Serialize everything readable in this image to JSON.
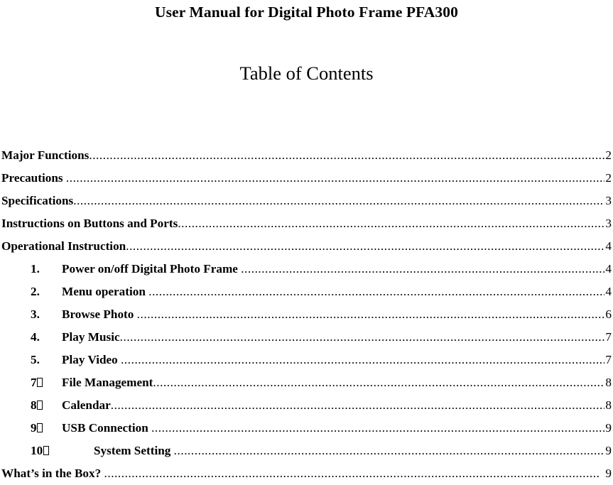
{
  "document": {
    "title": "User Manual for Digital Photo Frame PFA300",
    "toc_heading": "Table of Contents"
  },
  "toc": {
    "entries": [
      {
        "level": 1,
        "number": "",
        "label": "Major Functions",
        "gap_before_dots": false,
        "page": "2",
        "page_spaced": false
      },
      {
        "level": 1,
        "number": "",
        "label": "Precautions",
        "gap_before_dots": true,
        "page": "2",
        "page_spaced": false
      },
      {
        "level": 1,
        "number": "",
        "label": "Specifications",
        "gap_before_dots": false,
        "page": "3",
        "page_spaced": false
      },
      {
        "level": 1,
        "number": "",
        "label": "Instructions on Buttons and Ports",
        "gap_before_dots": false,
        "page": "3",
        "page_spaced": false
      },
      {
        "level": 1,
        "number": "",
        "label": "Operational Instruction",
        "gap_before_dots": false,
        "page": "4",
        "page_spaced": false
      },
      {
        "level": 2,
        "number": "1.",
        "label": "Power on/off Digital Photo Frame",
        "gap_before_dots": true,
        "page": "4",
        "page_spaced": false
      },
      {
        "level": 2,
        "number": "2.",
        "label": "Menu operation",
        "gap_before_dots": true,
        "page": "4",
        "page_spaced": false
      },
      {
        "level": 2,
        "number": "3.",
        "label": "Browse Photo",
        "gap_before_dots": true,
        "page": "6",
        "page_spaced": false
      },
      {
        "level": 2,
        "number": "4.",
        "label": "Play Music",
        "gap_before_dots": false,
        "page": "7",
        "page_spaced": false
      },
      {
        "level": 2,
        "number": "5.",
        "label": "Play Video",
        "gap_before_dots": true,
        "page": "7",
        "page_spaced": false
      },
      {
        "level": 2,
        "number": "7",
        "number_tofu": true,
        "label": "File Management",
        "gap_before_dots": false,
        "page": "8",
        "page_spaced": false
      },
      {
        "level": 2,
        "number": "8",
        "number_tofu": true,
        "label": "Calendar",
        "gap_before_dots": false,
        "page": "8",
        "page_spaced": false
      },
      {
        "level": 2,
        "number": "9",
        "number_tofu": true,
        "label": "USB Connection",
        "gap_before_dots": true,
        "page": "9",
        "page_spaced": false
      },
      {
        "level": 2,
        "number": "10",
        "number_tofu": true,
        "number_wide": true,
        "label": "System Setting",
        "gap_before_dots": true,
        "page": "9",
        "page_spaced": false
      },
      {
        "level": 1,
        "number": "",
        "label": "What’s in the Box?",
        "gap_before_dots": true,
        "page": "9",
        "page_spaced": true
      }
    ]
  }
}
